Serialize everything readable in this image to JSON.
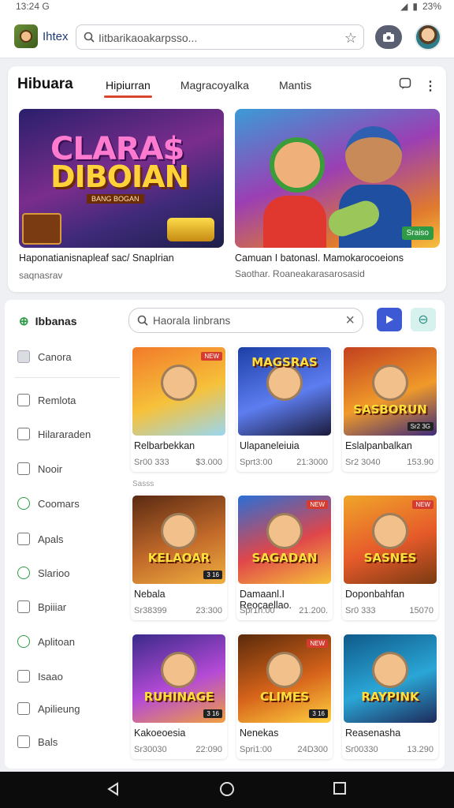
{
  "status": {
    "time": "13:24 G",
    "battery": "23%"
  },
  "header": {
    "brand": "Ihtex",
    "search_placeholder": "Iitbarikaoakarpsso...",
    "icons": [
      "smiley-logo",
      "search-icon",
      "star-icon",
      "camera-icon",
      "avatar"
    ]
  },
  "hero": {
    "title": "Hibuara",
    "tabs": [
      {
        "label": "Hipiurran",
        "active": true
      },
      {
        "label": "Magracoyalka",
        "active": false
      },
      {
        "label": "Mantis",
        "active": false
      }
    ],
    "banners": [
      {
        "art_line1": "CLARA$",
        "art_line2": "DIBOIAN",
        "strip": "BANG BOGAN",
        "caption": "Haponatianisnapleaf sac/ Snaplrian",
        "sub": "saqnasrav"
      },
      {
        "badge": "Sraiso",
        "caption": "Camuan I batonasl. Mamokarocoeions",
        "sub": "Saothar. Roaneakarasarosasid"
      }
    ]
  },
  "sidebar": {
    "heading": "Ibbanas",
    "items": [
      {
        "label": "Canora",
        "icon": "box-icon"
      },
      {
        "label": "Remlota",
        "icon": "doc-icon"
      },
      {
        "label": "Hilararaden",
        "icon": "check-square-icon"
      },
      {
        "label": "Nooir",
        "icon": "bookmark-icon"
      },
      {
        "label": "Coomars",
        "icon": "circle-icon"
      },
      {
        "label": "Apals",
        "icon": "home-icon"
      },
      {
        "label": "Slarioo",
        "icon": "grid-icon"
      },
      {
        "label": "Bpiiiar",
        "icon": "square-icon"
      },
      {
        "label": "Aplitoan",
        "icon": "refresh-icon"
      },
      {
        "label": "Isaao",
        "icon": "link-icon"
      },
      {
        "label": "Apilieung",
        "icon": "bell-icon"
      },
      {
        "label": "Bals",
        "icon": "layers-icon"
      }
    ]
  },
  "catalog": {
    "search_placeholder": "Haorala linbrans",
    "section_label": "Sasss",
    "cards": [
      {
        "name": "Relbarbekkan",
        "meta1": "Sr00 333",
        "meta2": "$3.000",
        "art": "",
        "tag": "NEW",
        "tag2": "",
        "theme": "a"
      },
      {
        "name": "Ulapaneleiuia",
        "meta1": "Sprt3:00",
        "meta2": "21:3000",
        "art": "MAGSRAS",
        "tag": "",
        "tag2": "",
        "theme": "b"
      },
      {
        "name": "Eslalpanbalkan",
        "meta1": "Sr2 3040",
        "meta2": "153.90",
        "art": "SASBORUN",
        "tag": "",
        "tag2": "Sr2 3G",
        "theme": "c"
      },
      {
        "name": "Nebala",
        "meta1": "Sr38399",
        "meta2": "23:300",
        "art": "KELAOAR",
        "tag": "",
        "tag2": "3 16",
        "theme": "d"
      },
      {
        "name": "Damaanl.I Reocaellao.",
        "meta1": "Spr1h:00",
        "meta2": "21.200.",
        "art": "SAGADAN",
        "tag": "NEW",
        "tag2": "",
        "theme": "e"
      },
      {
        "name": "Doponbahfan",
        "meta1": "Sr0 333",
        "meta2": "15070",
        "art": "SASNES",
        "tag": "NEW",
        "tag2": "",
        "theme": "f"
      },
      {
        "name": "Kakoeoesia",
        "meta1": "Sr30030",
        "meta2": "22:090",
        "art": "RUHINAGE",
        "tag": "",
        "tag2": "3 16",
        "theme": "g"
      },
      {
        "name": "Nenekas",
        "meta1": "Spri1:00",
        "meta2": "24D300",
        "art": "CLIMES",
        "tag": "NEW",
        "tag2": "3 16",
        "theme": "h"
      },
      {
        "name": "Reasenasha",
        "meta1": "Sr00330",
        "meta2": "13.290",
        "art": "RAYPINK",
        "tag": "",
        "tag2": "",
        "theme": "i"
      }
    ]
  },
  "colors": {
    "accent": "#d9462e",
    "primary": "#3d5ad4",
    "green": "#2f9a46"
  }
}
